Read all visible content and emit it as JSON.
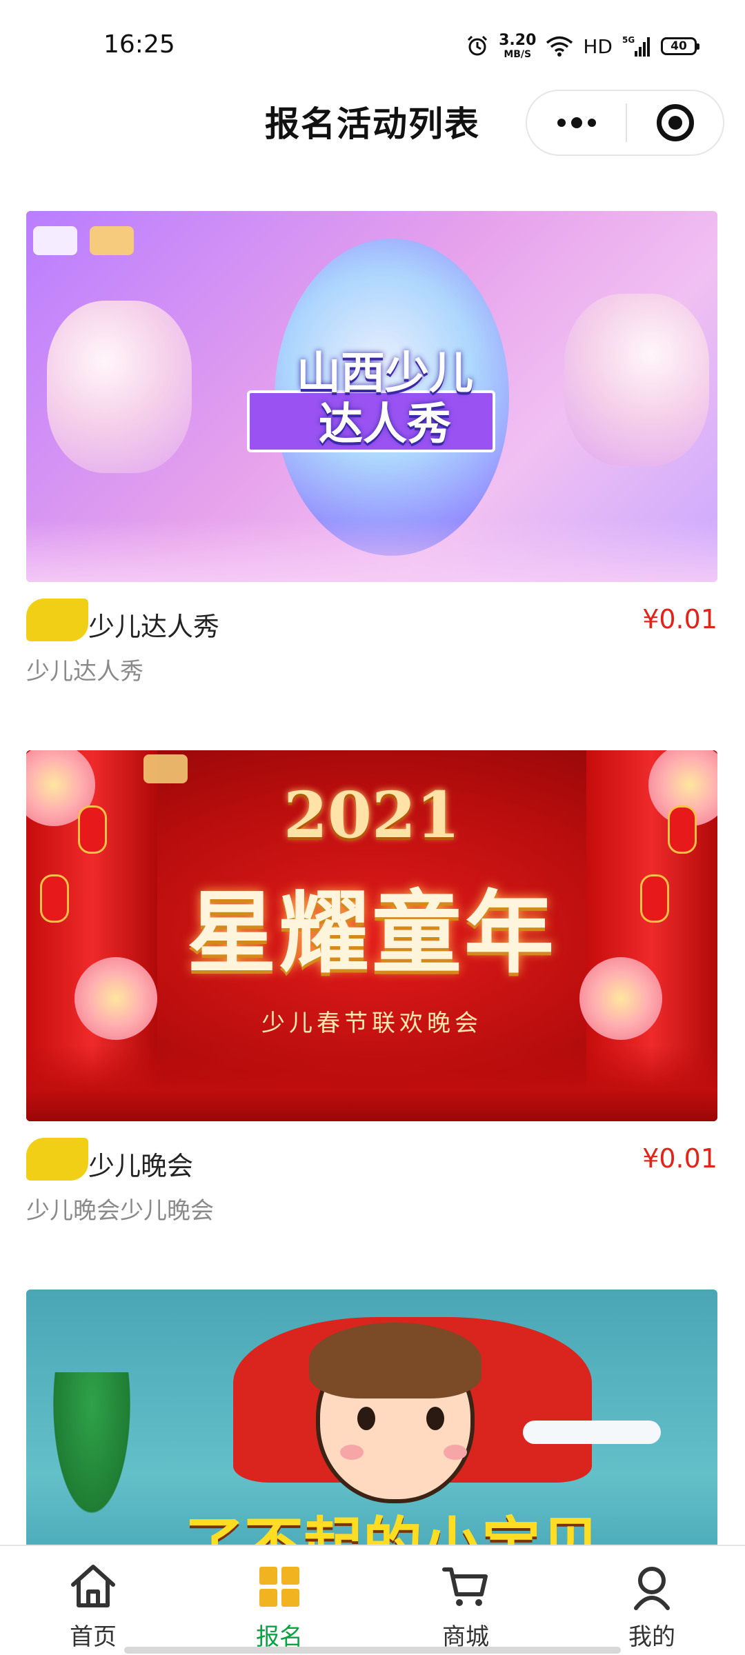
{
  "status_bar": {
    "time": "16:25",
    "net_speed_value": "3.20",
    "net_speed_unit": "MB/S",
    "hd": "HD",
    "network": "5G",
    "battery": "40"
  },
  "nav": {
    "title": "报名活动列表",
    "more_icon": "more-dots-icon",
    "close_icon": "target-close-icon"
  },
  "activities": [
    {
      "banner_title": "山西少儿\n达人秀",
      "name": "少儿达人秀",
      "price": "¥0.01",
      "desc": "少儿达人秀",
      "tag_color": "#f1cf16"
    },
    {
      "banner_year": "2021",
      "banner_title": "星耀童年",
      "banner_sub": "少儿春节联欢晚会",
      "name": "少儿晚会",
      "price": "¥0.01",
      "desc": "少儿晚会少儿晚会",
      "tag_color": "#f1cf16"
    },
    {
      "banner_title": "了不起的小宝贝"
    }
  ],
  "tabbar": {
    "items": [
      {
        "label": "首页",
        "icon": "home-icon",
        "active": false
      },
      {
        "label": "报名",
        "icon": "grid-icon",
        "active": true
      },
      {
        "label": "商城",
        "icon": "cart-icon",
        "active": false
      },
      {
        "label": "我的",
        "icon": "user-icon",
        "active": false
      }
    ],
    "active_color": "#0aa344",
    "active_icon_color": "#f2b321"
  },
  "colors": {
    "price": "#e2231a",
    "tag": "#f1cf16",
    "desc": "#8a8a8a"
  }
}
